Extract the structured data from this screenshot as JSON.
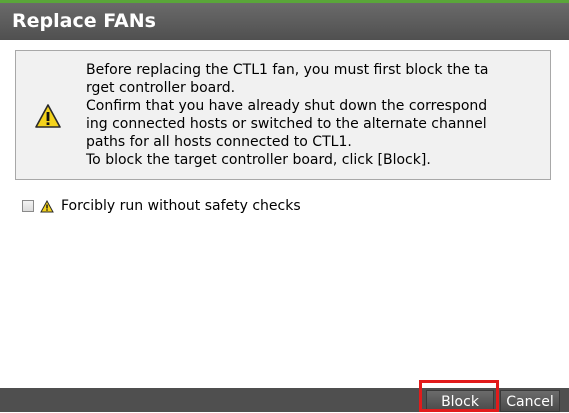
{
  "dialog": {
    "title": "Replace FANs"
  },
  "message": {
    "icon": "warning-icon",
    "lines": [
      "Before replacing the CTL1 fan, you must first block the ta",
      "rget controller board.",
      "Confirm that you have already shut down the correspond",
      "ing connected hosts or switched to the alternate channel",
      "paths for all hosts connected to CTL1.",
      "To block the target controller board, click [Block]."
    ]
  },
  "options": {
    "force_label": "Forcibly run without safety checks",
    "force_checked": false
  },
  "buttons": {
    "block_label": "Block",
    "cancel_label": "Cancel"
  },
  "colors": {
    "titlebar": "#5a5a5a",
    "accent": "#5aa63a",
    "highlight": "#e21b1b",
    "warning": "#f2d21b"
  }
}
